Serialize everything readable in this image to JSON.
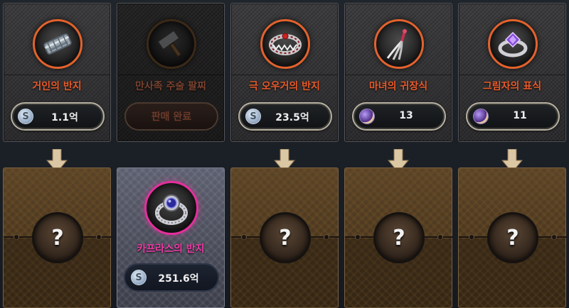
{
  "slots": [
    {
      "name": "거인의 반지",
      "price": "1.1억",
      "currency_icon": "silver-coin-icon",
      "item_icon": "ring-icon",
      "status": "available"
    },
    {
      "name": "만사족 주술 팔찌",
      "sold_label": "판매 완료",
      "item_icon": "hammer-icon",
      "status": "sold"
    },
    {
      "name": "극 오우거의 반지",
      "price": "23.5억",
      "currency_icon": "silver-coin-icon",
      "item_icon": "fanged-ring-icon",
      "status": "available"
    },
    {
      "name": "마녀의 귀장식",
      "price": "13",
      "currency_icon": "essence-icon",
      "item_icon": "feather-earring-icon",
      "status": "available"
    },
    {
      "name": "그림자의 표식",
      "price": "11",
      "currency_icon": "essence-icon",
      "item_icon": "amethyst-ring-icon",
      "status": "available"
    }
  ],
  "results": [
    {
      "unknown_label": "?"
    },
    {
      "name": "카프라스의 반지",
      "price": "251.6억",
      "currency_icon": "silver-coin-icon",
      "item_icon": "jeweled-ring-icon",
      "revealed": true
    },
    {
      "unknown_label": "?"
    },
    {
      "unknown_label": "?"
    },
    {
      "unknown_label": "?"
    }
  ],
  "coin_glyph": "S",
  "colors": {
    "orange_name": "#ea5a2a",
    "pink_name": "#f03ba8",
    "sold_name": "#7a4330",
    "accent_ring": "#e2622c"
  }
}
